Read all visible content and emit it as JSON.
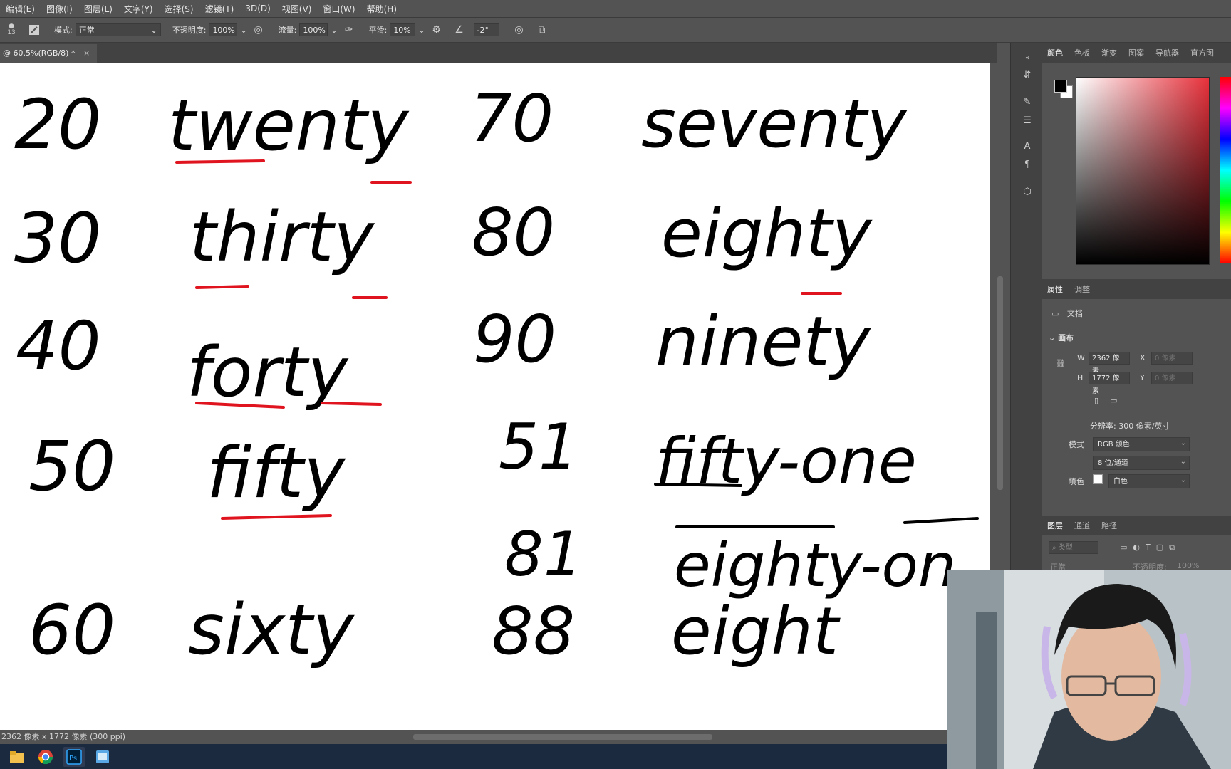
{
  "menu": [
    "编辑(E)",
    "图像(I)",
    "图层(L)",
    "文字(Y)",
    "选择(S)",
    "滤镜(T)",
    "3D(D)",
    "视图(V)",
    "窗口(W)",
    "帮助(H)"
  ],
  "options": {
    "brush_size": "13",
    "mode_label": "模式:",
    "mode_value": "正常",
    "opacity_label": "不透明度:",
    "opacity_value": "100%",
    "flow_label": "流量:",
    "flow_value": "100%",
    "smooth_label": "平滑:",
    "smooth_value": "10%",
    "angle_value": "-2°"
  },
  "document_tab": {
    "title": "@ 60.5%(RGB/8) *",
    "close": "×"
  },
  "status": {
    "info": "2362 像素 x 1772 像素 (300 ppi)"
  },
  "handwriting": {
    "rows": [
      {
        "num": "20",
        "word": "twenty",
        "num2": "70",
        "word2": "seventy"
      },
      {
        "num": "30",
        "word": "thirty",
        "num2": "80",
        "word2": "eighty"
      },
      {
        "num": "40",
        "word": "forty",
        "num2": "90",
        "word2": "ninety"
      },
      {
        "num": "50",
        "word": "fifty",
        "num2": "51",
        "word2": "fifty-one"
      },
      {
        "num": "",
        "word": "",
        "num2": "81",
        "word2": "eighty-on"
      },
      {
        "num": "60",
        "word": "sixty",
        "num2": "88",
        "word2": "eight"
      }
    ],
    "ink_color": "#000000",
    "highlight_color": "#e0141e"
  },
  "color_panel": {
    "tabs": [
      "颜色",
      "色板",
      "渐变",
      "图案",
      "导航器",
      "直方图"
    ],
    "active": "颜色"
  },
  "properties_panel": {
    "tabs": [
      "属性",
      "调整"
    ],
    "doc_label": "文档",
    "canvas_section": "画布",
    "w_label": "W",
    "w_value": "2362 像素",
    "h_label": "H",
    "h_value": "1772 像素",
    "x_label": "X",
    "x_value": "0 像素",
    "y_label": "Y",
    "y_value": "0 像素",
    "resolution": "分辨率: 300 像素/英寸",
    "mode_label": "模式",
    "mode_value": "RGB 颜色",
    "depth_value": "8 位/通道",
    "fill_label": "填色",
    "fill_value": "白色"
  },
  "layers_panel": {
    "tabs": [
      "图层",
      "通道",
      "路径"
    ],
    "search_placeholder": "类型",
    "blend": "正常",
    "opacity_label": "不透明度:",
    "opacity_value": "100%"
  }
}
